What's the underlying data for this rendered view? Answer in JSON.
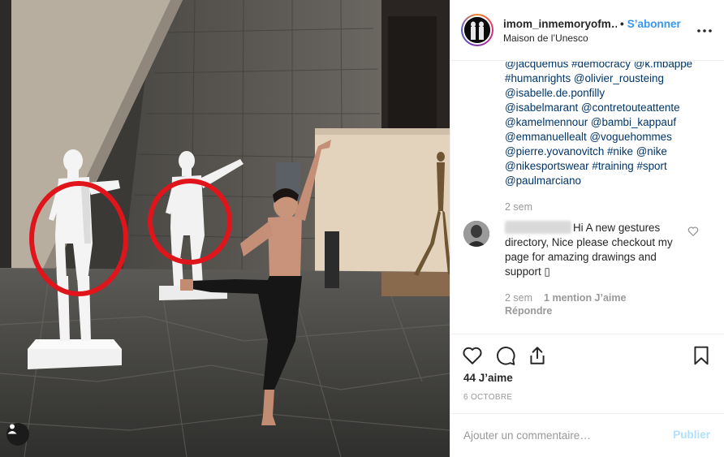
{
  "post": {
    "photo_alt": "",
    "header": {
      "username": "imom_inmemoryofm…",
      "separator": "•",
      "follow_label": "S’abonner",
      "location": "Maison de l’Unesco"
    },
    "caption": {
      "lines": [
        "@jacquemus #democracy @k.mbappe",
        "#humanrights @olivier_rousteing",
        "@isabelle.de.ponfilly",
        "@isabelmarant @contretouteattente",
        "@kamelmennour @bambi_kappauf",
        "@emmanuellealt @voguehommes",
        "@pierre.yovanovitch #nike @nike",
        "@nikesportswear #training #sport",
        "@paulmarciano"
      ],
      "time": "2 sem"
    },
    "comment": {
      "text": "Hi A new gestures directory, Nice please checkout my page for amazing drawings and support ▯",
      "time": "2 sem",
      "likes": "1 mention J’aime",
      "reply": "Répondre"
    },
    "likes_count": "44 J’aime",
    "date": "6 OCTOBRE",
    "add_comment_placeholder": "Ajouter un commentaire…",
    "publish_label": "Publier"
  },
  "icons": {
    "heart": "heart-icon",
    "comment": "comment-icon",
    "share": "share-icon",
    "bookmark": "bookmark-icon",
    "more": "more-options-icon",
    "user_tag": "user-tag-icon"
  },
  "colors": {
    "link": "#003569",
    "follow": "#3897f0",
    "muted": "#999999",
    "publish_disabled": "#b2dffc",
    "highlight_circle": "#e0141b"
  }
}
